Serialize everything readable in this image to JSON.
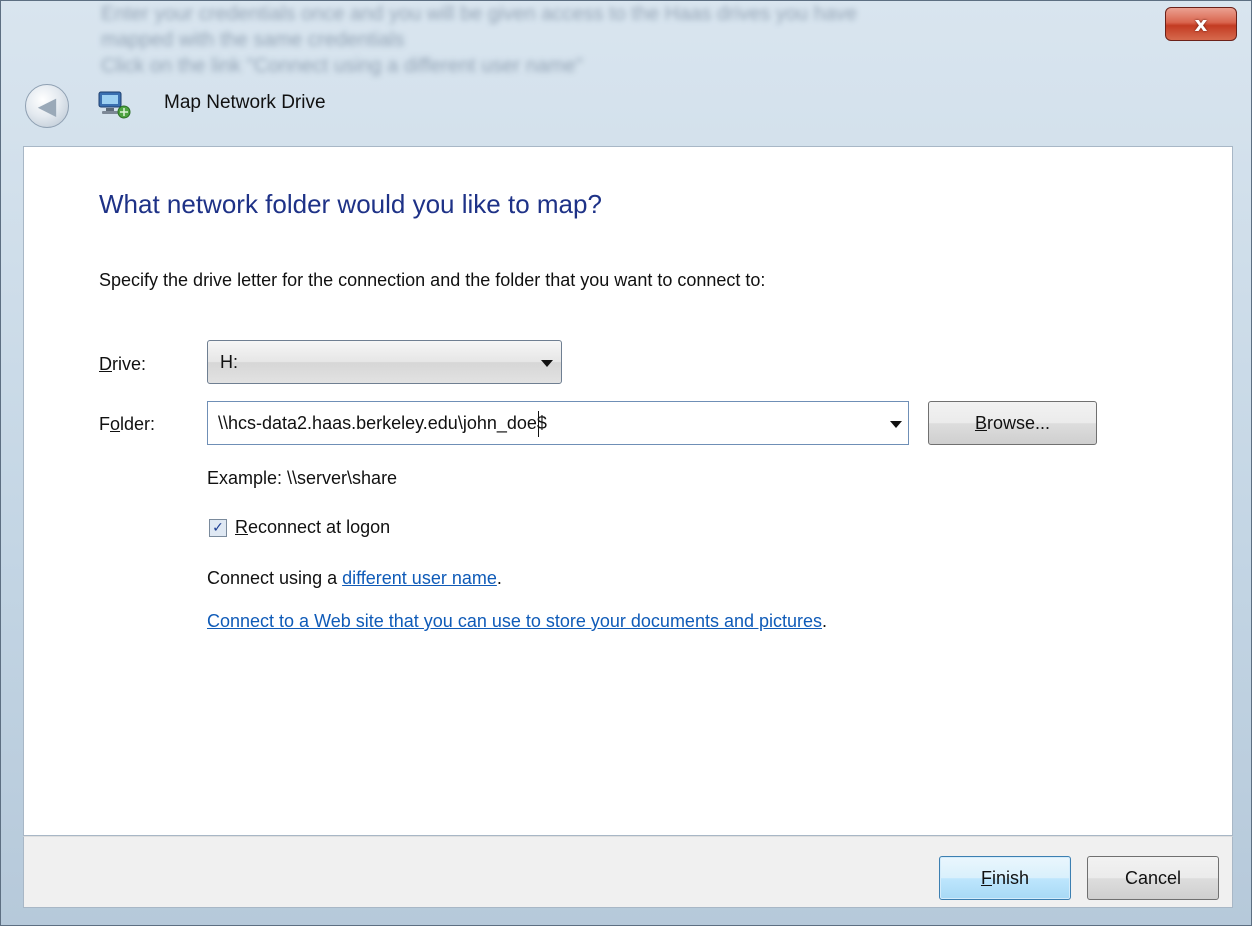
{
  "window": {
    "title": "Map Network Drive",
    "close_glyph": "x",
    "back_icon": "back-arrow-icon",
    "app_icon": "network-drive-icon",
    "background_text": [
      "Enter your credentials once and you will be given access to the Haas drives you have",
      "mapped with the same credentials",
      "Click on the link \"Connect using a different user name\""
    ]
  },
  "main": {
    "heading": "What network folder would you like to map?",
    "instructions": "Specify the drive letter for the connection and the folder that you want to connect to:"
  },
  "drive": {
    "label_accel": "D",
    "label_rest": "rive:",
    "value": "H:"
  },
  "folder": {
    "label_pre": "F",
    "label_accel": "o",
    "label_post": "lder:",
    "value": "\\\\hcs-data2.haas.berkeley.edu\\john_doe$",
    "browse_accel": "B",
    "browse_rest": "rowse..."
  },
  "example": "Example: \\\\server\\share",
  "reconnect": {
    "checked": true,
    "check_glyph": "✓",
    "label_accel": "R",
    "label_rest": "econnect at logon"
  },
  "connect_using": {
    "prefix": "Connect using a ",
    "link": "different user name",
    "suffix": "."
  },
  "web_site": {
    "link": "Connect to a Web site that you can use to store your documents and pictures",
    "suffix": "."
  },
  "footer": {
    "finish_accel": "F",
    "finish_rest": "inish",
    "cancel": "Cancel"
  },
  "colors": {
    "heading": "#1e3287",
    "link": "#0f5bb8",
    "close_button": "#c33b22",
    "default_button_border": "#3c7fb1"
  }
}
